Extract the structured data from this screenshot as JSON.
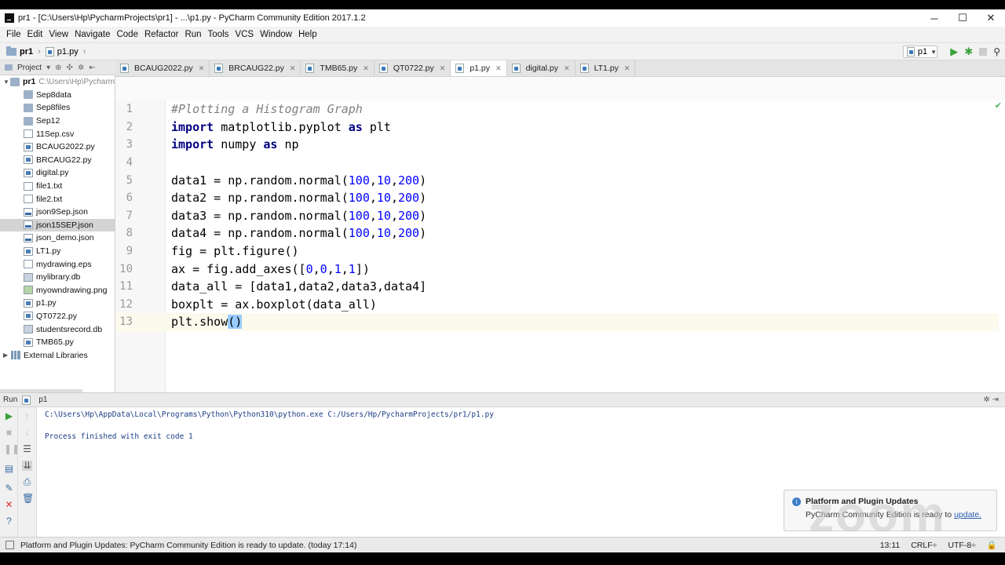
{
  "window": {
    "title": "pr1 - [C:\\Users\\Hp\\PycharmProjects\\pr1] - ...\\p1.py - PyCharm Community Edition 2017.1.2",
    "minimize": "─",
    "maximize": "☐",
    "close": "✕"
  },
  "menu": [
    "File",
    "Edit",
    "View",
    "Navigate",
    "Code",
    "Refactor",
    "Run",
    "Tools",
    "VCS",
    "Window",
    "Help"
  ],
  "nav": {
    "project": "pr1",
    "file": "p1.py",
    "run_config": "p1"
  },
  "project_panel": {
    "label": "Project",
    "root": {
      "name": "pr1",
      "path": "C:\\Users\\Hp\\Pycharm"
    },
    "items": [
      {
        "name": "Sep8data",
        "type": "folder"
      },
      {
        "name": "Sep8files",
        "type": "folder"
      },
      {
        "name": "Sep12",
        "type": "folder"
      },
      {
        "name": "11Sep.csv",
        "type": "txt"
      },
      {
        "name": "BCAUG2022.py",
        "type": "py"
      },
      {
        "name": "BRCAUG22.py",
        "type": "py"
      },
      {
        "name": "digital.py",
        "type": "py"
      },
      {
        "name": "file1.txt",
        "type": "txt"
      },
      {
        "name": "file2.txt",
        "type": "txt"
      },
      {
        "name": "json9Sep.json",
        "type": "json"
      },
      {
        "name": "json15SEP.json",
        "type": "json",
        "selected": true
      },
      {
        "name": "json_demo.json",
        "type": "json"
      },
      {
        "name": "LT1.py",
        "type": "py"
      },
      {
        "name": "mydrawing.eps",
        "type": "txt"
      },
      {
        "name": "mylibrary.db",
        "type": "db"
      },
      {
        "name": "myowndrawing.png",
        "type": "img"
      },
      {
        "name": "p1.py",
        "type": "py"
      },
      {
        "name": "QT0722.py",
        "type": "py"
      },
      {
        "name": "studentsrecord.db",
        "type": "db"
      },
      {
        "name": "TMB65.py",
        "type": "py"
      }
    ],
    "external": "External Libraries"
  },
  "tabs": [
    {
      "label": "BCAUG2022.py"
    },
    {
      "label": "BRCAUG22.py"
    },
    {
      "label": "TMB65.py"
    },
    {
      "label": "QT0722.py"
    },
    {
      "label": "p1.py",
      "active": true
    },
    {
      "label": "digital.py"
    },
    {
      "label": "LT1.py"
    }
  ],
  "code": {
    "line_numbers": [
      "1",
      "2",
      "3",
      "4",
      "5",
      "6",
      "7",
      "8",
      "9",
      "10",
      "11",
      "12",
      "13"
    ],
    "l1": "#Plotting a Histogram Graph",
    "l2": {
      "kw1": "import",
      "mod": " matplotlib.pyplot ",
      "kw2": "as",
      "alias": " plt"
    },
    "l3": {
      "kw1": "import",
      "mod": " numpy ",
      "kw2": "as",
      "alias": " np"
    },
    "l5": {
      "pre": "data1 = np.random.normal(",
      "a": "100",
      "b": "10",
      "c": "200",
      "post": ")"
    },
    "l6": {
      "pre": "data2 = np.random.normal(",
      "a": "100",
      "b": "10",
      "c": "200",
      "post": ")"
    },
    "l7": {
      "pre": "data3 = np.random.normal(",
      "a": "100",
      "b": "10",
      "c": "200",
      "post": ")"
    },
    "l8": {
      "pre": "data4 = np.random.normal(",
      "a": "100",
      "b": "10",
      "c": "200",
      "post": ")"
    },
    "l9": "fig = plt.figure()",
    "l10": {
      "pre": "ax = fig.add_axes([",
      "n1": "0",
      "n2": "0",
      "n3": "1",
      "n4": "1",
      "post": "])"
    },
    "l11": "data_all = [data1,data2,data3,data4]",
    "l12": "boxplt = ax.boxplot(data_all)",
    "l13": {
      "pre": "plt.show",
      "hl": "()"
    }
  },
  "run": {
    "label": "Run",
    "config": "p1",
    "command": "C:\\Users\\Hp\\AppData\\Local\\Programs\\Python\\Python310\\python.exe C:/Users/Hp/PycharmProjects/pr1/p1.py",
    "result": "Process finished with exit code 1"
  },
  "notification": {
    "title": "Platform and Plugin Updates",
    "body": "PyCharm Community Edition is ready to ",
    "link": "update."
  },
  "watermark": "zoom",
  "status": {
    "message": "Platform and Plugin Updates: PyCharm Community Edition is ready to update. (today 17:14)",
    "position": "13:11",
    "line_sep": "CRLF÷",
    "encoding": "UTF-8÷"
  }
}
